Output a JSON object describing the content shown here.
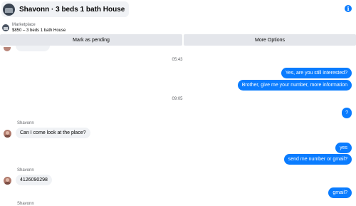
{
  "header": {
    "title": "Shavonn · 3 beds 1 bath House",
    "info_icon": "info-icon"
  },
  "marketplace": {
    "label": "Marketplace",
    "listing": "$850 – 3 beds 1 bath House"
  },
  "actions": {
    "mark_pending": "Mark as pending",
    "more_options": "More Options"
  },
  "colors": {
    "outgoing_bubble": "#0a7cff",
    "incoming_bubble": "#f0f2f5",
    "button_bg": "#e4e6eb"
  },
  "conversation": {
    "time_1": "05:43",
    "msg_out_1": "Yes, are you still interested?",
    "msg_out_2": "Brother, give me your number, more information",
    "time_2": "09:05",
    "msg_out_3": "?",
    "sender_1": "Shavonn",
    "msg_in_1": "Can I come look at the place?",
    "msg_out_4": "yes",
    "msg_out_5": "send me number or gmail?",
    "sender_2": "Shavonn",
    "msg_in_2": "4126090298",
    "msg_out_6": "gmail?",
    "sender_3": "Shavonn"
  }
}
